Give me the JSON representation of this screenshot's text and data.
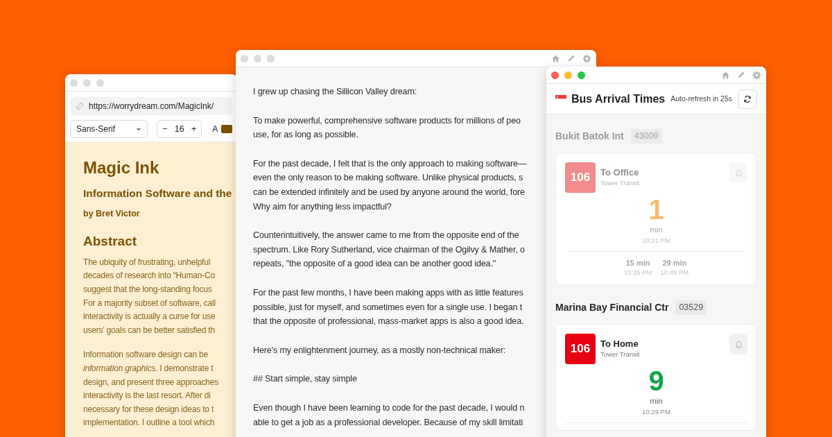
{
  "windows": [
    {
      "kind": "reader",
      "active": false,
      "url": "https://worrydream.com/MagicInk/",
      "font_select": "Sans-Serif",
      "decrement": "−",
      "font_size": "16",
      "increment": "+",
      "color_label": "A",
      "title": "Magic Ink",
      "subtitle": "Information Software and the",
      "byline": "by Bret Victor",
      "heading": "Abstract",
      "paragraphs": [
        "The ubiquity of frustrating, unhelpful\ndecades of research into “Human-Co\nsuggest that the long-standing focus\nFor a majority subset of software, call\ninteractivity is actually a curse for use\nusers’ goals can be better satisfied th",
        "Information software design can be\n*information graphics*. I demonstrate t\ndesign, and present three approaches\ninteractivity is the last resort. After di\nnecessary for these design ideas to t\nimplementation. I outline a tool which"
      ]
    },
    {
      "kind": "editor",
      "active": false,
      "paragraphs": [
        "I grew up chasing the Sillicon Valley dream:",
        "To make powerful, comprehensive software products for millions of peo\nuse, for as long as possible.",
        "For the past decade, I felt that is the only approach to making software—\neven the only reason to be making software. Unlike physical products, s\ncan be extended infinitely and be used by anyone around the world, fore\nWhy aim for anything less impactful?",
        "Counterintuitively, the answer came to me from the opposite end of the\nspectrum. Like Rory Sutherland, vice chairman of the Ogilvy & Mather, o\nrepeats, \"the opposite of a good idea can be another good idea.\"",
        "For the past few months, I have been making apps with as little features\npossible, just for myself, and sometimes even for a single use. I began t\nthat the opposite of professional, mass-market apps is also a good idea.",
        "Here's my enlightenment journey, as a mostly non-technical maker:",
        "## Start simple, stay simple",
        "Even though I have been learning to code for the past decade, I would n\nable to get a job as a professional developer. Because of my skill limitati"
      ]
    },
    {
      "kind": "bus",
      "active": true,
      "title": "Bus Arrival Times",
      "refresh_note": "Auto-refresh in 25s",
      "stops": [
        {
          "name": "Bukit Batok Int",
          "code": "43009",
          "dimmed": true,
          "services": [
            {
              "route": {
                "number": "106",
                "color": "#f28b8b"
              },
              "destination": "To Office",
              "operator": "Tower Transit",
              "next": {
                "minutes": "1",
                "unit": "min",
                "time": "10:21 PM",
                "color": "#fdba74"
              },
              "later": [
                {
                  "minutes": "15 min",
                  "time": "10:35 PM"
                },
                {
                  "minutes": "29 min",
                  "time": "10:49 PM"
                }
              ]
            }
          ]
        },
        {
          "name": "Marina Bay Financial Ctr",
          "code": "03529",
          "dimmed": false,
          "services": [
            {
              "route": {
                "number": "106",
                "color": "#e60012"
              },
              "destination": "To Home",
              "operator": "Tower Transit",
              "next": {
                "minutes": "9",
                "unit": "min",
                "time": "10:29 PM",
                "color": "#16a34a"
              }
            }
          ]
        }
      ]
    }
  ]
}
